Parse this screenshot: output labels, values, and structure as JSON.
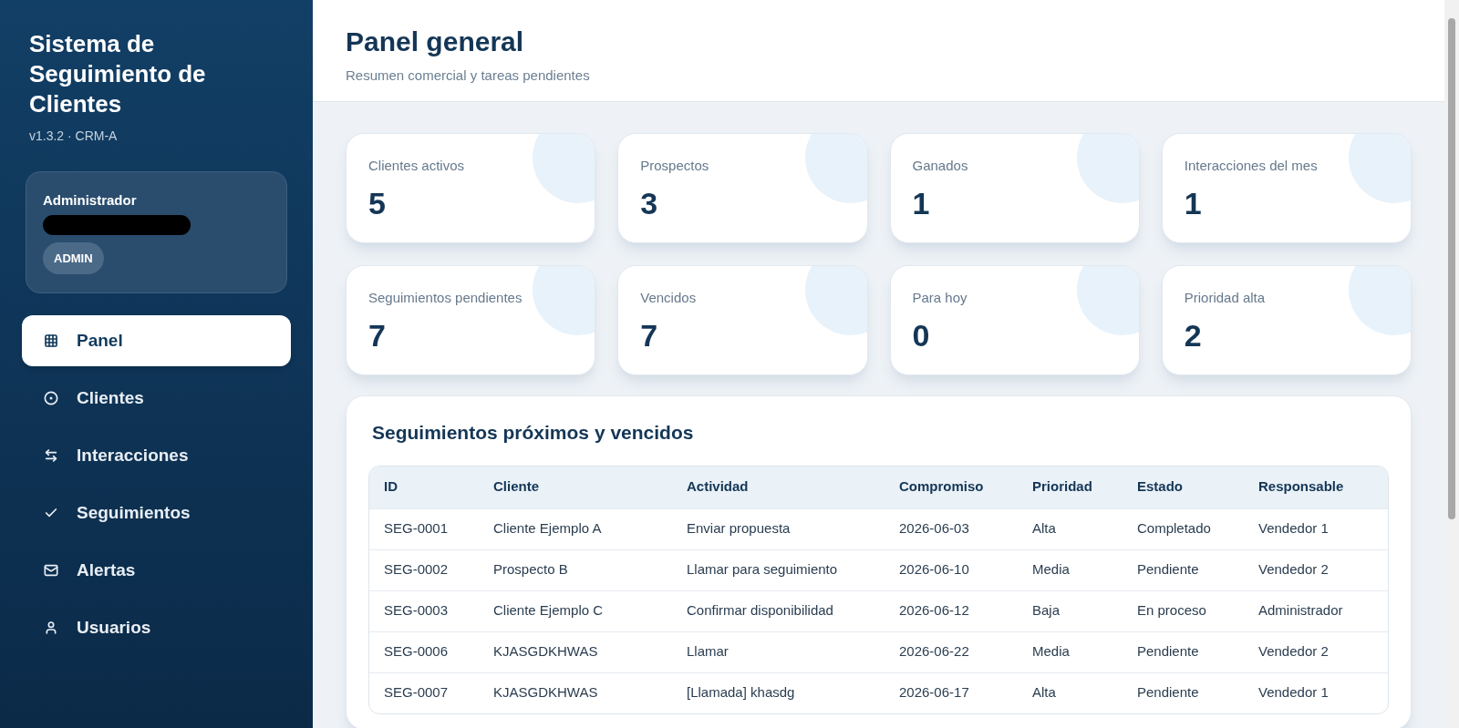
{
  "sidebar": {
    "title": "Sistema de Seguimiento de Clientes",
    "version": "v1.3.2 · CRM-A",
    "user": {
      "role": "Administrador",
      "badge": "ADMIN"
    },
    "items": [
      {
        "label": "Panel",
        "kind": "grid",
        "selected": true
      },
      {
        "label": "Clientes",
        "kind": "circle",
        "selected": false
      },
      {
        "label": "Interacciones",
        "kind": "arrows",
        "selected": false
      },
      {
        "label": "Seguimientos",
        "kind": "check",
        "selected": false
      },
      {
        "label": "Alertas",
        "kind": "mail",
        "selected": false
      },
      {
        "label": "Usuarios",
        "kind": "user",
        "selected": false
      }
    ]
  },
  "header": {
    "title": "Panel general",
    "subtitle": "Resumen comercial y tareas pendientes"
  },
  "stats": [
    {
      "label": "Clientes activos",
      "value": "5"
    },
    {
      "label": "Prospectos",
      "value": "3"
    },
    {
      "label": "Ganados",
      "value": "1"
    },
    {
      "label": "Interacciones del mes",
      "value": "1"
    },
    {
      "label": "Seguimientos pendientes",
      "value": "7"
    },
    {
      "label": "Vencidos",
      "value": "7"
    },
    {
      "label": "Para hoy",
      "value": "0"
    },
    {
      "label": "Prioridad alta",
      "value": "2"
    }
  ],
  "table": {
    "title": "Seguimientos próximos y vencidos",
    "columns": [
      "ID",
      "Cliente",
      "Actividad",
      "Compromiso",
      "Prioridad",
      "Estado",
      "Responsable"
    ],
    "rows": [
      [
        "SEG-0001",
        "Cliente Ejemplo A",
        "Enviar propuesta",
        "2026-06-03",
        "Alta",
        "Completado",
        "Vendedor 1"
      ],
      [
        "SEG-0002",
        "Prospecto B",
        "Llamar para seguimiento",
        "2026-06-10",
        "Media",
        "Pendiente",
        "Vendedor 2"
      ],
      [
        "SEG-0003",
        "Cliente Ejemplo C",
        "Confirmar disponibilidad",
        "2026-06-12",
        "Baja",
        "En proceso",
        "Administrador"
      ],
      [
        "SEG-0006",
        "KJASGDKHWAS",
        "Llamar",
        "2026-06-22",
        "Media",
        "Pendiente",
        "Vendedor 2"
      ],
      [
        "SEG-0007",
        "KJASGDKHWAS",
        "[Llamada] khasdg",
        "2026-06-17",
        "Alta",
        "Pendiente",
        "Vendedor 1"
      ]
    ]
  }
}
